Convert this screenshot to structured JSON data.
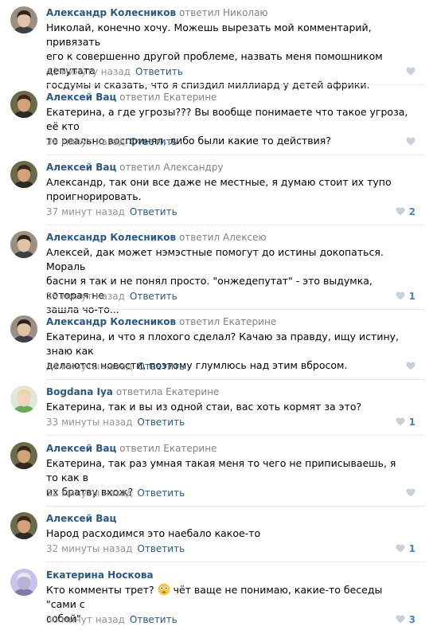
{
  "comments": [
    {
      "author": "Александр Колесников",
      "replied": "ответил Николаю",
      "lines": [
        "Николай, конечно хочу. Можешь вырезать мой комментарий, привязать",
        "его к совершенно другой проблеме, назвать меня помошником депутата",
        "госдумы и сказать, что я спиздил миллиард у детей африки."
      ],
      "time": "41 минуту назад",
      "reply": "Ответить",
      "likes": "",
      "avatar": "alexander-kolesnikov-avatar"
    },
    {
      "author": "Алексей Вац",
      "replied": "ответил Екатерине",
      "lines": [
        "Екатерина, а где угрозы??? Вы вообще понимаете что такое угроза, её кто",
        "то реально воспринял, либо были какие то действия?"
      ],
      "time": "38 минут назад",
      "reply": "Ответить",
      "likes": "",
      "avatar": "aleksey-vats-avatar"
    },
    {
      "author": "Алексей Вац",
      "replied": "ответил Александру",
      "lines": [
        "Александр, так они все даже не местные, я думаю стоит их тупо",
        "проигнорировать."
      ],
      "time": "37 минут назад",
      "reply": "Ответить",
      "likes": "2",
      "avatar": "aleksey-vats-avatar"
    },
    {
      "author": "Александр Колесников",
      "replied": "ответил Алексею",
      "lines": [
        "Алексей, дак может нэмэстные помогут до истины докопаться. Мораль",
        "басни я так и не понял просто. \"онжедепутат\" - это выдумка, которая не",
        "зашла чо-то..."
      ],
      "time": "35 минут назад",
      "reply": "Ответить",
      "likes": "1",
      "avatar": "alexander-kolesnikov-avatar"
    },
    {
      "author": "Александр Колесников",
      "replied": "ответил Екатерине",
      "lines": [
        "Екатерина, и что я плохого сделал? Качаю за правду, ищу истину, знаю как",
        "делаются новости, поэтому глумлюсь над этим вбросом."
      ],
      "time": "34 минуты назад",
      "reply": "Ответить",
      "likes": "",
      "avatar": "alexander-kolesnikov-avatar"
    },
    {
      "author": "Bogdana Iya",
      "replied": "ответила Екатерине",
      "lines": [
        "Екатерина, так и вы из одной стаи, вас хоть кормят за это?"
      ],
      "time": "33 минуты назад",
      "reply": "Ответить",
      "likes": "1",
      "avatar": "bogdana-iya-avatar"
    },
    {
      "author": "Алексей Вац",
      "replied": "ответил Екатерине",
      "lines": [
        "Екатерина, так раз умная такая меня то чего не приписываешь, я то как в",
        "их братву вхож?"
      ],
      "time": "32 минуты назад",
      "reply": "Ответить",
      "likes": "",
      "avatar": "aleksey-vats-avatar"
    },
    {
      "author": "Алексей Вац",
      "replied": "",
      "lines": [
        "Народ расходимся это наебало какое-то"
      ],
      "time": "32 минуты назад",
      "reply": "Ответить",
      "likes": "1",
      "avatar": "aleksey-vats-avatar"
    },
    {
      "author": "Екатерина Носкова",
      "replied": "",
      "lines": [
        "Кто комменты трет? {emoji} чёт ваще не понимаю, какие-то беседы \"сами с",
        "собой\""
      ],
      "time": "30 минут назад",
      "reply": "Ответить",
      "likes": "3",
      "avatar": "ekaterina-noskova-avatar"
    }
  ],
  "colors": {
    "author": "#2a5885",
    "muted": "#939393",
    "like": "#5181b8",
    "separator": "#e7e8ec"
  },
  "icons": {
    "like": "heart-icon",
    "emoji": "flushed-face-emoji"
  }
}
